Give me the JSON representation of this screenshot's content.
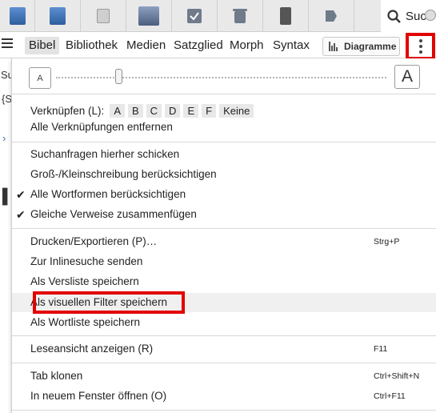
{
  "tabs": [
    {
      "name": "tab-1",
      "color": "#3b6fb0"
    },
    {
      "name": "tab-2",
      "color": "#3b6fb0"
    },
    {
      "name": "tab-3",
      "color": "#8a8a8a"
    },
    {
      "name": "tab-4",
      "color": "#6b7d99"
    },
    {
      "name": "tab-5",
      "color": "#6f7b8a"
    },
    {
      "name": "tab-6",
      "color": "#6f7b8a"
    },
    {
      "name": "tab-7",
      "color": "#555555"
    },
    {
      "name": "tab-8",
      "color": "#6f7b8a"
    }
  ],
  "active_tab": {
    "label": "Suc",
    "icon": "search-icon"
  },
  "menubar": {
    "items": [
      "Bibel",
      "Bibliothek",
      "Medien",
      "Satzglied",
      "Morph",
      "Syntax"
    ],
    "diagram_button": "Diagramme"
  },
  "background": {
    "frag1": "Su",
    "frag2": "{S"
  },
  "font_slider": {
    "small_label": "A",
    "large_label": "A",
    "value": 0.19
  },
  "link": {
    "label": "Verknüpfen (L):",
    "options": [
      "A",
      "B",
      "C",
      "D",
      "E",
      "F",
      "Keine"
    ],
    "remove_all": "Alle Verknüpfungen entfernen"
  },
  "search_options": {
    "send_here": "Suchanfragen hierher schicken",
    "case_sensitive": "Groß-/Kleinschreibung berücksichtigen",
    "all_word_forms": "Alle Wortformen berücksichtigen",
    "merge_references": "Gleiche Verweise zusammenfügen",
    "all_word_forms_checked": true,
    "merge_references_checked": true
  },
  "export": {
    "print_export": "Drucken/Exportieren (P)…",
    "print_shortcut": "Strg+P",
    "send_inline": "Zur Inlinesuche senden",
    "save_verse_list": "Als Versliste speichern",
    "save_visual_filter": "Als visuellen Filter speichern",
    "save_word_list": "Als Wortliste speichern"
  },
  "view": {
    "reading_view": "Leseansicht anzeigen (R)",
    "reading_shortcut": "F11"
  },
  "window": {
    "clone_tab": "Tab klonen",
    "clone_shortcut": "Ctrl+Shift+N",
    "new_window": "In neuem Fenster öffnen (O)",
    "new_window_shortcut": "Ctrl+F11"
  },
  "colors": {
    "highlight_border": "#e20000"
  }
}
